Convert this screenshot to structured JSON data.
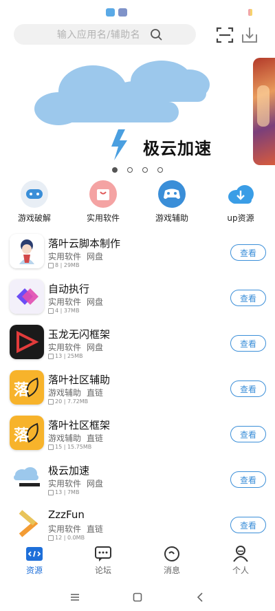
{
  "search": {
    "placeholder": "输入应用名/辅助名"
  },
  "banner": {
    "title": "极云加速",
    "page_count": 4,
    "active_page": 1
  },
  "categories": [
    {
      "label": "游戏破解",
      "icon": "gamepad-icon"
    },
    {
      "label": "实用软件",
      "icon": "shopping-bag-icon"
    },
    {
      "label": "游戏辅助",
      "icon": "controller-icon"
    },
    {
      "label": "up资源",
      "icon": "cloud-download-icon"
    }
  ],
  "apps": [
    {
      "name": "落叶云脚本制作",
      "tag1": "实用软件",
      "tag2": "网盘",
      "meta": "8 | 29MB",
      "button": "查看"
    },
    {
      "name": "自动执行",
      "tag1": "实用软件",
      "tag2": "网盘",
      "meta": "4 | 37MB",
      "button": "查看"
    },
    {
      "name": "玉龙无闪框架",
      "tag1": "实用软件",
      "tag2": "网盘",
      "meta": "13 | 25MB",
      "button": "查看"
    },
    {
      "name": "落叶社区辅助",
      "tag1": "游戏辅助",
      "tag2": "直链",
      "meta": "20 | 7.72MB",
      "button": "查看"
    },
    {
      "name": "落叶社区框架",
      "tag1": "游戏辅助",
      "tag2": "直链",
      "meta": "15 | 15.75MB",
      "button": "查看"
    },
    {
      "name": "极云加速",
      "tag1": "实用软件",
      "tag2": "网盘",
      "meta": "13 | 7MB",
      "button": "查看"
    },
    {
      "name": "ZzzFun",
      "tag1": "实用软件",
      "tag2": "直链",
      "meta": "12 | 0.0MB",
      "button": "查看"
    }
  ],
  "tabs": [
    {
      "label": "资源",
      "icon": "code-icon",
      "active": true
    },
    {
      "label": "论坛",
      "icon": "chat-icon",
      "active": false
    },
    {
      "label": "消息",
      "icon": "message-icon",
      "active": false
    },
    {
      "label": "个人",
      "icon": "user-icon",
      "active": false
    }
  ],
  "colors": {
    "accent": "#1e6fd9",
    "button_border": "#3a8ed8",
    "cloud": "#9cc8ec"
  }
}
